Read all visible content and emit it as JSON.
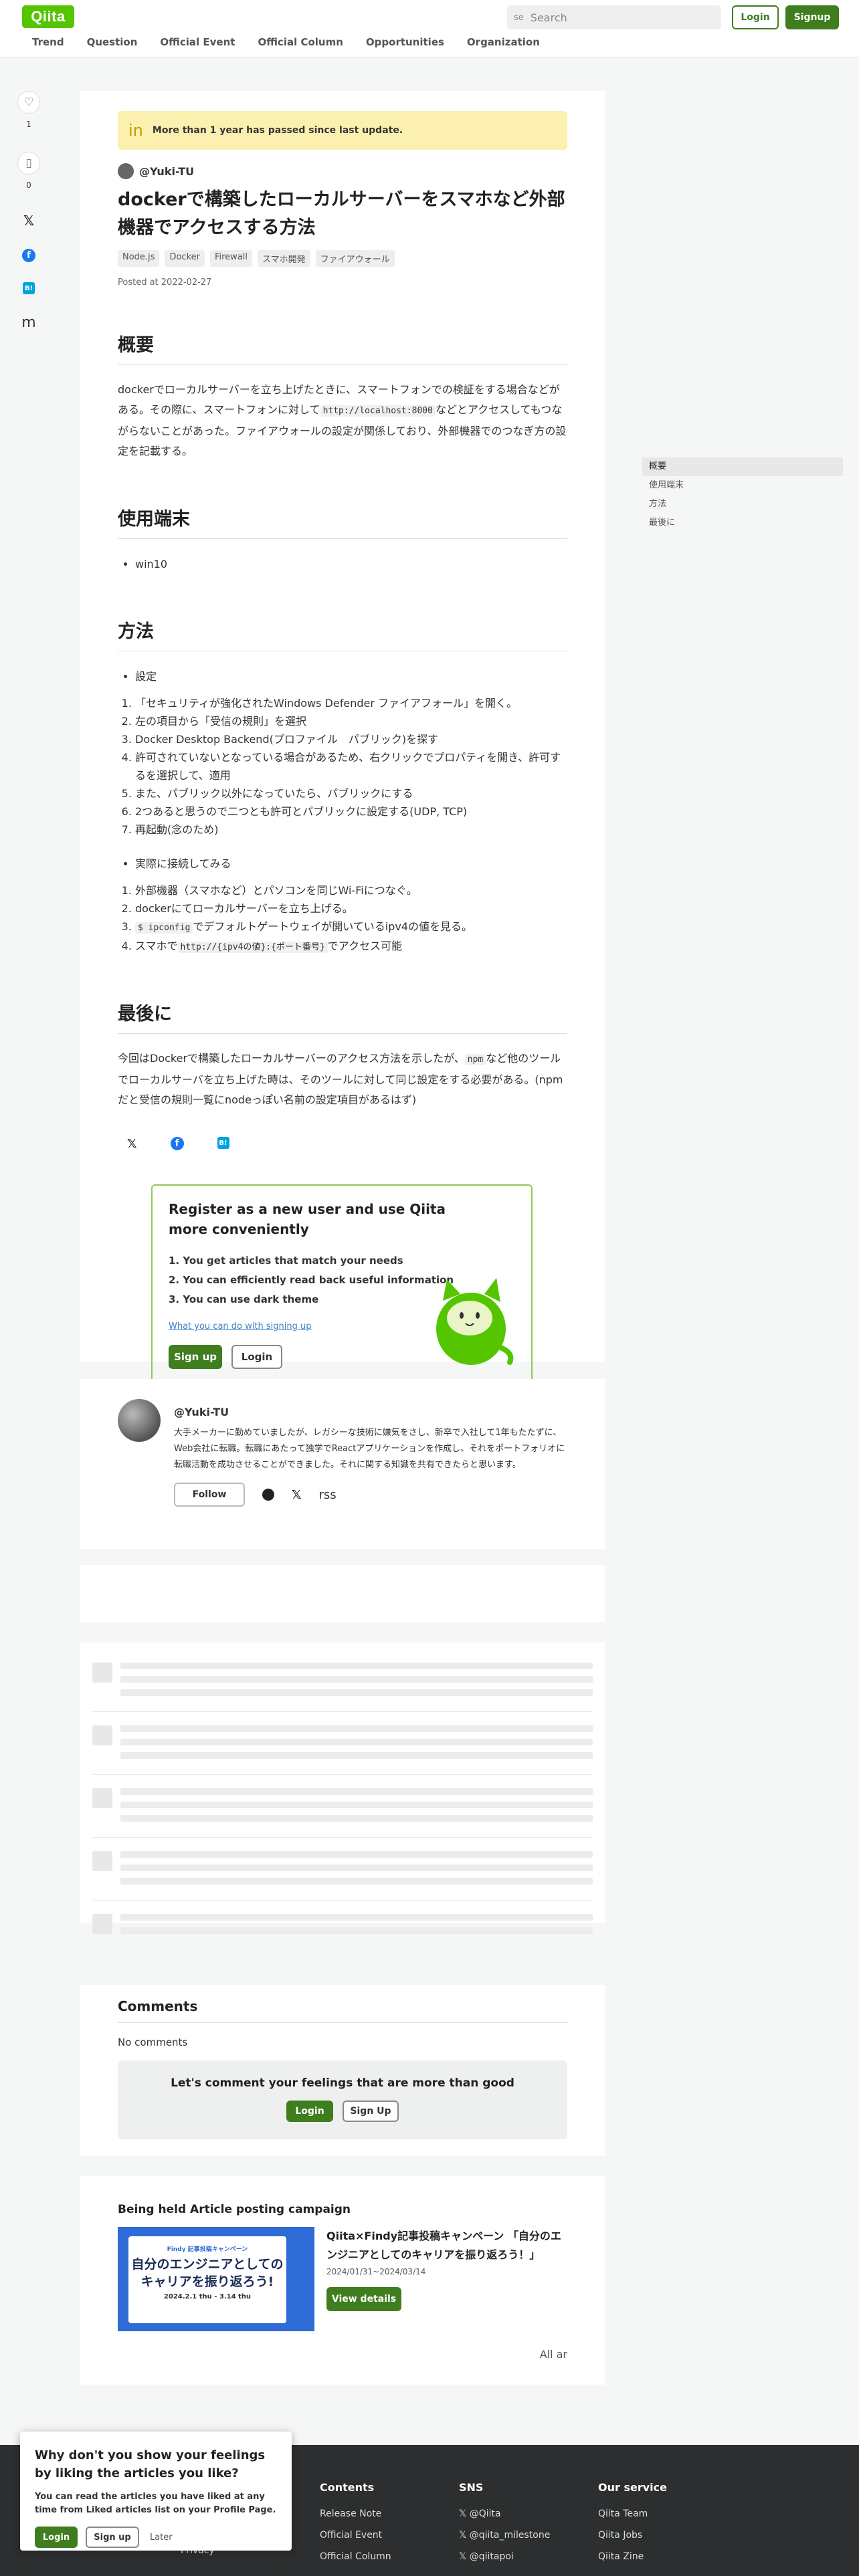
{
  "header": {
    "logo": "Qiita",
    "search_placeholder": "Search",
    "search_icon_glyph": "se",
    "login": "Login",
    "signup": "Signup",
    "nav": [
      "Trend",
      "Question",
      "Official Event",
      "Official Column",
      "Opportunities",
      "Organization"
    ]
  },
  "side": {
    "like_count": "1",
    "stock_count": "0"
  },
  "article": {
    "notice": "More than 1 year has passed since last update.",
    "author": "@Yuki-TU",
    "title": "dockerで構築したローカルサーバーをスマホなど外部機器でアクセスする方法",
    "tags": [
      "Node.js",
      "Docker",
      "Firewall",
      "スマホ開発",
      "ファイアウォール"
    ],
    "posted": "Posted at 2022-02-27",
    "sec1_title": "概要",
    "sec1_p_a": "dockerでローカルサーバーを立ち上げたときに、スマートフォンでの検証をする場合などがある。その際に、スマートフォンに対して",
    "sec1_code": "http://localhost:8000",
    "sec1_p_b": "などとアクセスしてもつながらないことがあった。ファイアウォールの設定が関係しており、外部機器でのつなぎ方の設定を記載する。",
    "sec2_title": "使用端末",
    "sec2_items": [
      "win10"
    ],
    "sec3_title": "方法",
    "sec3_bullet1": "設定",
    "sec3_steps1": [
      "「セキュリティが強化されたWindows Defender ファイアフォール」を開く。",
      "左の項目から「受信の規則」を選択",
      "Docker Desktop Backend(プロファイル　パブリック)を探す",
      "許可されていないとなっている場合があるため、右クリックでプロパティを開き、許可するを選択して、適用",
      "また、パブリック以外になっていたら、パブリックにする",
      "2つあると思うので二つとも許可とパブリックに設定する(UDP, TCP)",
      "再起動(念のため)"
    ],
    "sec3_bullet2": "実際に接続してみる",
    "sec3_steps2_1": "外部機器（スマホなど）とパソコンを同じWi-Fiにつなぐ。",
    "sec3_steps2_2": "dockerにてローカルサーバーを立ち上げる。",
    "sec3_steps2_3_code": "$ ipconfig",
    "sec3_steps2_3_text": "でデフォルトゲートウェイが開いているipv4の値を見る。",
    "sec3_steps2_4_a": "スマホで",
    "sec3_steps2_4_code": "http://{ipv4の値}:{ポート番号}",
    "sec3_steps2_4_b": "でアクセス可能",
    "sec4_title": "最後に",
    "sec4_p_a": "今回はDockerで構築したローカルサーバーのアクセス方法を示したが、",
    "sec4_code": "npm",
    "sec4_p_b": "など他のツールでローカルサーバを立ち上げた時は、そのツールに対して同じ設定をする必要がある。(npmだと受信の規則一覧にnodeっぽい名前の設定項目があるはず)"
  },
  "register": {
    "title": "Register as a new user and use Qiita more conveniently",
    "items": [
      "1. You get articles that match your needs",
      "2. You can efficiently read back useful information",
      "3. You can use dark theme"
    ],
    "link": "What you can do with signing up",
    "signup": "Sign up",
    "login": "Login"
  },
  "profile": {
    "name": "@Yuki-TU",
    "bio": "大手メーカーに勤めていましたが、レガシーな技術に嫌気をさし、新卒で入社して1年もたたずに、Web会社に転職。転職にあたって独学でReactアプリケーションを作成し、それをポートフォリオに転職活動を成功させることができました。それに関する知識を共有できたらと思います。",
    "follow": "Follow",
    "rss": "rss"
  },
  "comments": {
    "title": "Comments",
    "none": "No comments",
    "prompt": "Let's comment your feelings that are more than good",
    "login": "Login",
    "signup": "Sign Up"
  },
  "campaign": {
    "heading": "Being held Article posting campaign",
    "img_small": "Findy 記事投稿キャンペーン",
    "img_big": "自分のエンジニアとしてのキャリアを振り返ろう!",
    "img_date": "2024.2.1 thu - 3.14 thu",
    "title": "Qiita×Findy記事投稿キャンペーン 「自分のエンジニアとしてのキャリアを振り返ろう！」",
    "date": "2024/01/31~2024/03/14",
    "button": "View details",
    "all": "All ar"
  },
  "toc": [
    "概要",
    "使用端末",
    "方法",
    "最後に"
  ],
  "footer": {
    "contents_title": "Contents",
    "contents": [
      "Release Note",
      "Official Event",
      "Official Column"
    ],
    "sns_title": "SNS",
    "sns": [
      "@Qiita",
      "@qiita_milestone",
      "@qiitapoi"
    ],
    "service_title": "Our service",
    "service": [
      "Qiita Team",
      "Qiita Jobs",
      "Qiita Zine"
    ],
    "left_item": "Privacy"
  },
  "popup": {
    "title": "Why don't you show your feelings by liking the articles you like?",
    "body": "You can read the articles you have liked at any time from Liked articles list on your Profile Page.",
    "login": "Login",
    "signup": "Sign up",
    "later": "Later"
  }
}
